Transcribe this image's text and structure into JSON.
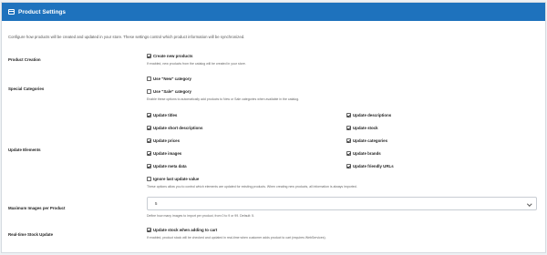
{
  "header": {
    "title": "Product Settings",
    "icon": "archive-box-icon"
  },
  "intro": "Configure how products will be created and updated in your store. These settings control which product information will be synchronized.",
  "product_creation": {
    "label": "Product Creation",
    "option": {
      "label": "Create new products",
      "checked": true
    },
    "help": "If enabled, new products from the catalog will be created in your store."
  },
  "special_categories": {
    "label": "Special Categories",
    "new": {
      "label": "Use \"New\" category",
      "checked": false
    },
    "sale": {
      "label": "Use \"Sale\" category",
      "checked": false
    },
    "help": "Enable these options to automatically add products to New or Sale categories when available in the catalog."
  },
  "update_elements": {
    "label": "Update Elements",
    "left": [
      {
        "label": "Update titles",
        "checked": true
      },
      {
        "label": "Update short descriptions",
        "checked": true
      },
      {
        "label": "Update prices",
        "checked": true
      },
      {
        "label": "Update images",
        "checked": true
      },
      {
        "label": "Update meta data",
        "checked": true
      }
    ],
    "right": [
      {
        "label": "Update descriptions",
        "checked": true
      },
      {
        "label": "Update stock",
        "checked": true
      },
      {
        "label": "Update categories",
        "checked": true
      },
      {
        "label": "Update brands",
        "checked": true
      },
      {
        "label": "Update friendly URLs",
        "checked": true
      }
    ],
    "ignore_last": {
      "label": "Ignore last update value",
      "checked": false
    },
    "help": "These options allow you to control which elements are updated for existing products. When creating new products, all information is always imported."
  },
  "max_images": {
    "label": "Maximum Images per Product",
    "value": "5",
    "help": "Define how many images to import per product, from 0 to 9 or 99. Default: 5."
  },
  "realtime_stock": {
    "label": "Real-time Stock Update",
    "option": {
      "label": "Update stock when adding to cart",
      "checked": true
    },
    "help": "If enabled, product stock will be checked and updated in real-time when customer adds product to cart (requires WebServices)."
  }
}
